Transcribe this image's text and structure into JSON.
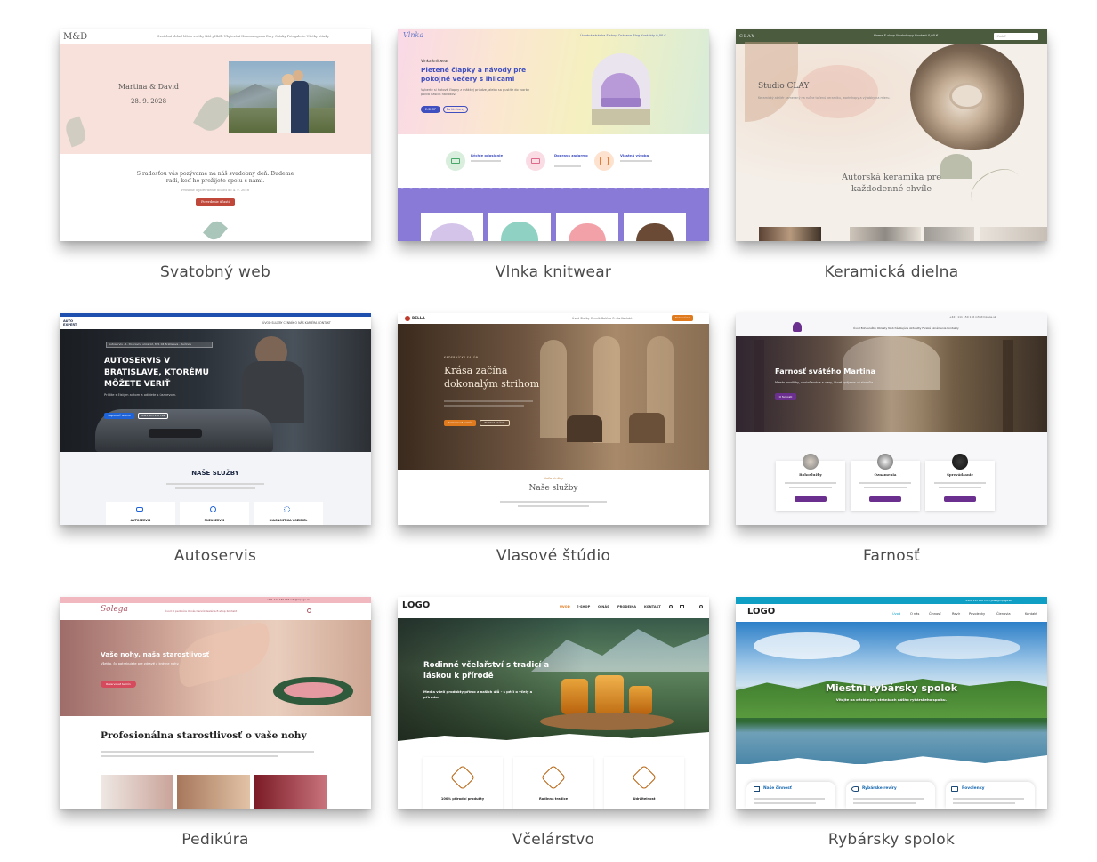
{
  "templates": [
    {
      "caption": "Svatobný web",
      "content": {
        "logo": "M&D",
        "nav": "Svatební obřad   Místo svatby   Náš příběh   Ubytování   Harmonogram   Dary   Otázky   Fotogalerie   Všetky otázky",
        "names": "Martina & David",
        "date": "28. 9. 2028",
        "invite": "S radosťou vás pozývame na náš svadobný deň. Budeme radi, keď ho prežijete spolu s nami.",
        "rsvp_note": "Prosíme o potvrdenie účasti do 4. 9. 2028",
        "button": "Potvrdenie účasti"
      }
    },
    {
      "caption": "Vlnka knitwear",
      "content": {
        "logo": "Vlnka",
        "nav": "Úvodná stránka   E-shop   Ochrana   Blog   Kontakty   0,00 €",
        "eyebrow": "Vlnka knitwear",
        "headline": "Pletené čiapky a návody pre pokojné večery s ihlicami",
        "text": "Vyberte si hotové čiapky z mäkkej priadze, alebo sa pustite do tvorby podľa našich návodov.",
        "btn1": "E-SHOP",
        "btn2": "Do tím kurzy",
        "features": [
          "Rýchle odoslanie",
          "Doprava zadarmo",
          "Vlastná výroba"
        ]
      }
    },
    {
      "caption": "Keramická dielna",
      "content": {
        "logo": "CLAY",
        "nav": "Home   E-shop   Workshopy   Kontakt   0,00 €",
        "search": "Hľadať",
        "title": "Studio CLAY",
        "text": "Keramický ateliér zameraný na ručne točenú keramiku, workshopy a výrobky na mieru.",
        "tagline": "Autorská keramika pre každodenné chvíle"
      }
    },
    {
      "caption": "Autoservis",
      "content": {
        "logo": "AUTO EXPERT",
        "nav": "ÚVOD   SLUŽBY   CENNÍK   O NÁS   KARIÉRA   KONTAKT",
        "address": "Autoservis - 1. Dopravná ulica 12, 821 04 Bratislava - Ružinov",
        "headline": "AUTOSERVIS V BRATISLAVE, KTORÉMU MÔŽETE VERIŤ",
        "text": "Prídite s čistým autom a odídete s úsmevom.",
        "btn1": "OBJEDNAŤ SERVIS",
        "btn2": "+421 123 456 789",
        "services_title": "NAŠE SLUŽBY",
        "services": [
          "AUTOSERVIS",
          "PNEUSERVIS",
          "DIAGNOSTIKA VOZIDIEL"
        ]
      }
    },
    {
      "caption": "Vlasové štúdio",
      "content": {
        "logo": "BELLA",
        "nav": "Úvod   Služby   Cenník   Galéria   O nás   Kontakt",
        "nav_btn": "Rezervácia",
        "eyebrow": "KADERNÍCKY SALÓN",
        "headline": "Krása začína dokonalým strihom",
        "btn1": "Rezervovať termín",
        "btn2": "Prehľad služieb",
        "services_eyebrow": "Naše služby",
        "services_title": "Naše služby"
      }
    },
    {
      "caption": "Farnosť",
      "content": {
        "contact": "+421 111 150 136   info@mpage.sk",
        "nav": "Úvod   Bohoslužby   Oblasty   Nadchádzajúce   Aktuality   Farská oznámenia   Kontakty",
        "headline": "Farnosť svätého Martina",
        "text": "Miesto modlitby, spoločenstva a viery, ktoré spájame už storočia",
        "btn": "O farnosti",
        "cards": [
          "Bohoslužby",
          "Oznámenia",
          "Sprevádzanie"
        ]
      }
    },
    {
      "caption": "Pedikúra",
      "content": {
        "contact": "+421 111 150 136   info@mpage.sk",
        "logo": "Solega",
        "nav": "Úvod   O pedikúre   O nás   Cenník   Galéria   E-shop   Kontakt",
        "headline": "Vaše nohy, naša starostlivosť",
        "text": "Všetko, čo potrebujete pre zdravé a krásne nohy.",
        "btn": "Rezervovať termín",
        "section_title": "Profesionálna starostlivosť o vaše nohy"
      }
    },
    {
      "caption": "Včelárstvo",
      "content": {
        "logo": "LOGO",
        "nav": [
          "ÚVOD",
          "E-SHOP",
          "O NÁS",
          "PRODEJNA",
          "KONTAKT"
        ],
        "headline": "Rodinné včelařství s tradicí a láskou k přírodě",
        "text": "Med a včelí produkty přímo z našich úlů - s péčí o včely a přírodu.",
        "features": [
          "100% přírodní produkty",
          "Rodinná tradice",
          "Udržitelnost"
        ]
      }
    },
    {
      "caption": "Rybársky spolok",
      "content": {
        "contact": "+421 111 150 136   rybari@mpage.sk",
        "logo": "LOGO",
        "nav": [
          "Úvod",
          "O nás",
          "Činnosť",
          "Revír",
          "Povolenky",
          "Členovia",
          "Kontakt"
        ],
        "headline": "Miestni rybársky spolok",
        "text": "Vitajte na oficiálnych stránkach nášho rybárskeho spolku.",
        "cards": [
          "Naše činnosť",
          "Rybárske revíry",
          "Povolenky"
        ]
      }
    }
  ]
}
